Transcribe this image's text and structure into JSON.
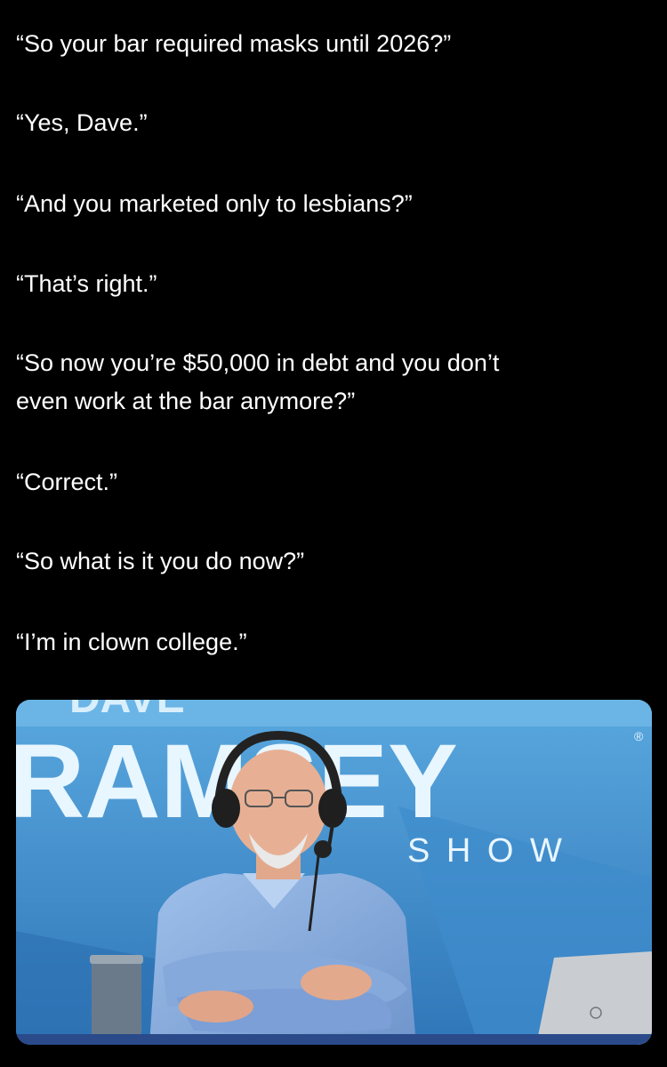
{
  "post": {
    "lines": [
      "“So your bar required masks until 2026?”",
      "“Yes, Dave.”",
      "“And you marketed only to lesbians?”",
      "“That’s right.”",
      "“So now you’re $50,000 in debt and you don’t",
      "even work at the bar anymore?”",
      "“Correct.”",
      "“So what is it you do now?”",
      "“I’m in clown college.”"
    ]
  },
  "media": {
    "banner_top_text": "DAVE",
    "brand_text": "RAMSEY",
    "show_text": "S H O W",
    "registered_mark": "®",
    "colors": {
      "banner_blue": "#4f9fd8",
      "banner_text": "#e6f6ff",
      "studio_blue": "#3b86c6"
    }
  }
}
